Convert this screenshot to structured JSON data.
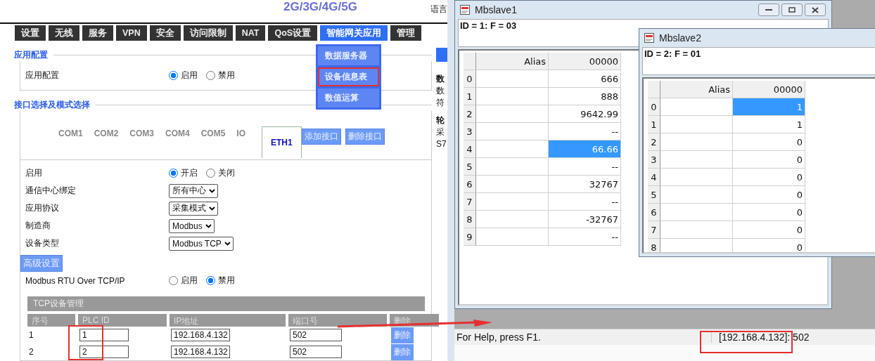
{
  "header": {
    "banner": "2G/3G/4G/5G",
    "language": "语言"
  },
  "nav": {
    "tabs": [
      {
        "label": "设置",
        "selected": false
      },
      {
        "label": "无线",
        "selected": false
      },
      {
        "label": "服务",
        "selected": false
      },
      {
        "label": "VPN",
        "selected": false
      },
      {
        "label": "安全",
        "selected": false
      },
      {
        "label": "访问限制",
        "selected": false
      },
      {
        "label": "NAT",
        "selected": false
      },
      {
        "label": "QoS设置",
        "selected": false
      },
      {
        "label": "智能网关应用",
        "selected": true
      },
      {
        "label": "管理",
        "selected": false
      }
    ],
    "menu": [
      {
        "label": "数据服务器",
        "selected": false
      },
      {
        "label": "设备信息表",
        "selected": true
      },
      {
        "label": "数值运算",
        "selected": false
      }
    ]
  },
  "app_config": {
    "legend": "应用配置",
    "label": "应用配置",
    "options": [
      {
        "label": "启用",
        "selected": true
      },
      {
        "label": "禁用",
        "selected": false
      }
    ]
  },
  "interface": {
    "legend": "接口选择及模式选择",
    "tabs": [
      {
        "label": "COM1",
        "selected": false
      },
      {
        "label": "COM2",
        "selected": false
      },
      {
        "label": "COM3",
        "selected": false
      },
      {
        "label": "COM4",
        "selected": false
      },
      {
        "label": "COM5",
        "selected": false
      },
      {
        "label": "IO",
        "selected": false
      },
      {
        "label": "ETH1",
        "selected": true
      }
    ],
    "buttons": [
      "添加接口",
      "删除接口"
    ]
  },
  "form": [
    {
      "kind": "radio",
      "label": "启用",
      "options": [
        {
          "label": "开启",
          "selected": true
        },
        {
          "label": "关闭",
          "selected": false
        }
      ]
    },
    {
      "kind": "select",
      "label": "通信中心绑定",
      "value": "所有中心"
    },
    {
      "kind": "select",
      "label": "应用协议",
      "value": "采集模式"
    },
    {
      "kind": "select",
      "label": "制造商",
      "value": "Modbus"
    },
    {
      "kind": "select",
      "label": "设备类型",
      "value": "Modbus TCP"
    },
    {
      "kind": "button",
      "label": "高级设置"
    },
    {
      "kind": "radio",
      "label": "Modbus RTU Over TCP/IP",
      "options": [
        {
          "label": "启用",
          "selected": false
        },
        {
          "label": "禁用",
          "selected": true
        }
      ]
    }
  ],
  "tcp_table": {
    "title": "TCP设备管理",
    "columns": [
      "序号",
      "PLC ID",
      "IP地址",
      "端口号",
      "删除"
    ],
    "rows": [
      {
        "index": "1",
        "plc_id": "1",
        "ip": "192.168.4.132",
        "port": "502",
        "action": "删除"
      },
      {
        "index": "2",
        "plc_id": "2",
        "ip": "192.168.4.132",
        "port": "502",
        "action": "删除"
      }
    ]
  },
  "side_fragments": [
    {
      "text": "数",
      "kind": "heading"
    },
    {
      "text": "数",
      "kind": "text"
    },
    {
      "text": "符",
      "kind": "text"
    },
    {
      "text": "轮",
      "kind": "heading"
    },
    {
      "text": "采",
      "kind": "text"
    },
    {
      "text": "S7",
      "kind": "text"
    }
  ],
  "slaves": [
    {
      "title": "Mbslave1",
      "info": "ID = 1: F = 03",
      "columns": [
        "Alias",
        "00000"
      ],
      "rows": [
        {
          "index": "0",
          "value": "666",
          "selected": false
        },
        {
          "index": "1",
          "value": "888",
          "selected": false
        },
        {
          "index": "2",
          "value": "9642.99",
          "selected": false
        },
        {
          "index": "3",
          "value": "--",
          "selected": false
        },
        {
          "index": "4",
          "value": "66.66",
          "selected": true
        },
        {
          "index": "5",
          "value": "--",
          "selected": false
        },
        {
          "index": "6",
          "value": "32767",
          "selected": false
        },
        {
          "index": "7",
          "value": "--",
          "selected": false
        },
        {
          "index": "8",
          "value": "-32767",
          "selected": false
        },
        {
          "index": "9",
          "value": "--",
          "selected": false
        }
      ]
    },
    {
      "title": "Mbslave2",
      "info": "ID = 2: F = 01",
      "columns": [
        "Alias",
        "00000"
      ],
      "rows": [
        {
          "index": "0",
          "value": "1",
          "selected": true
        },
        {
          "index": "1",
          "value": "1",
          "selected": false
        },
        {
          "index": "2",
          "value": "0",
          "selected": false
        },
        {
          "index": "3",
          "value": "0",
          "selected": false
        },
        {
          "index": "4",
          "value": "0",
          "selected": false
        },
        {
          "index": "5",
          "value": "0",
          "selected": false
        },
        {
          "index": "6",
          "value": "0",
          "selected": false
        },
        {
          "index": "7",
          "value": "0",
          "selected": false
        },
        {
          "index": "8",
          "value": "0",
          "selected": false
        }
      ]
    }
  ],
  "status_bar": {
    "help": "For Help, press F1.",
    "connection": "[192.168.4.132]: 502"
  }
}
